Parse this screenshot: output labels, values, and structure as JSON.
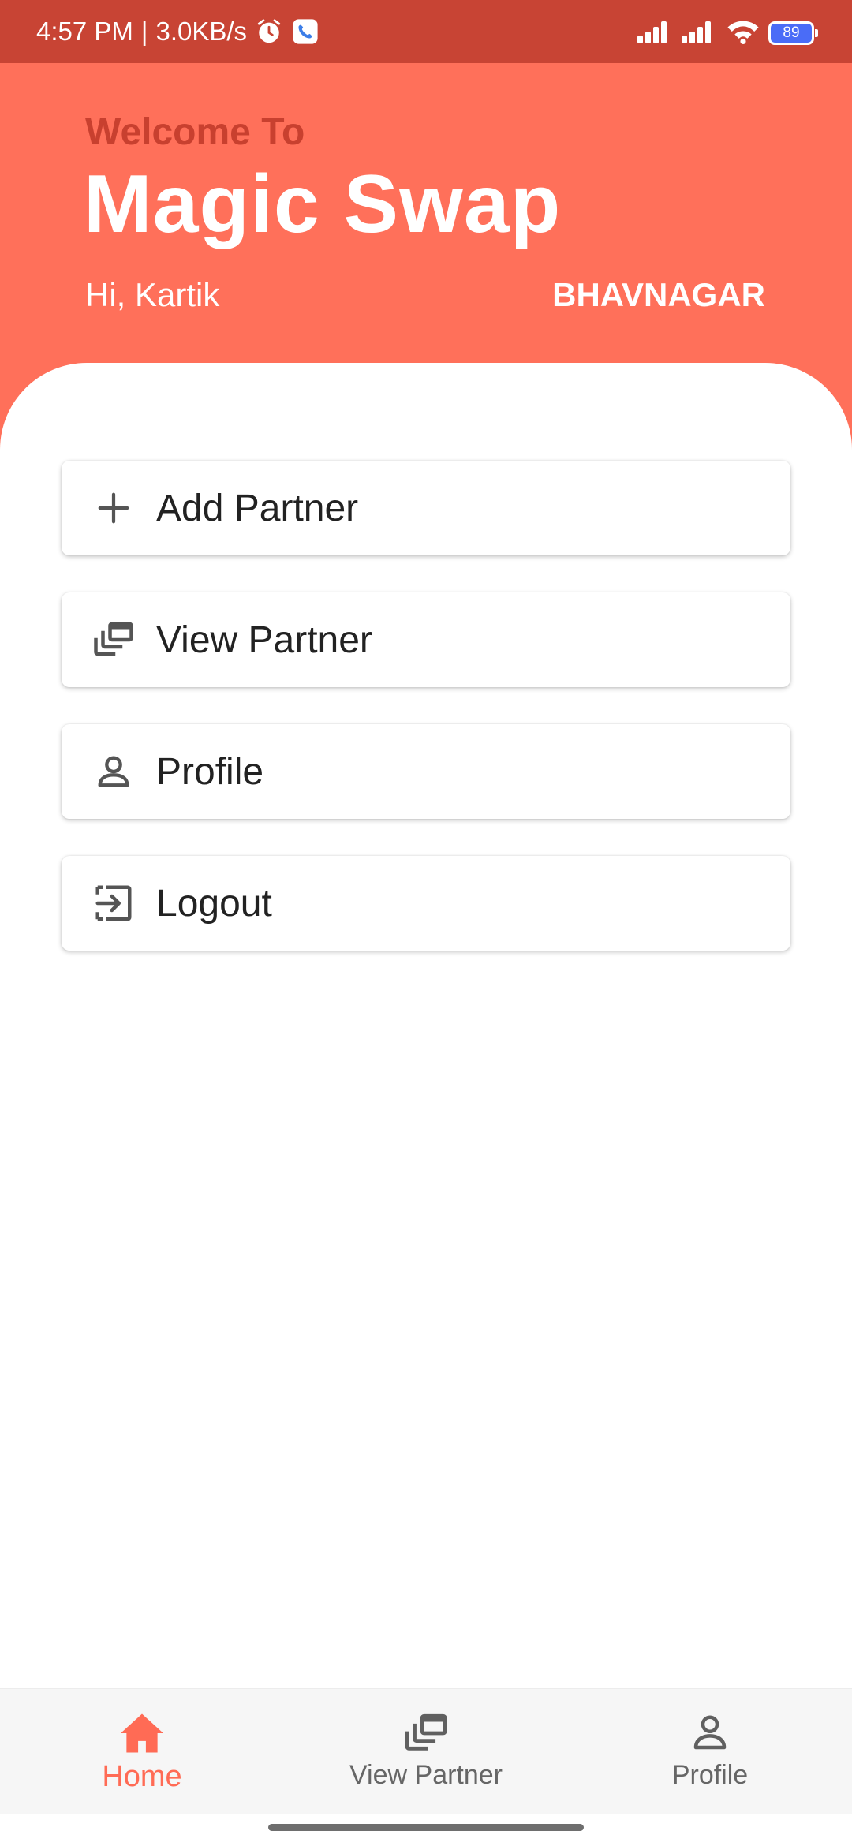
{
  "status_bar": {
    "time": "4:57 PM",
    "separator": "|",
    "network_speed": "3.0KB/s",
    "battery_level": "89",
    "icons": [
      "alarm-icon",
      "phone-call-icon",
      "signal-icon",
      "signal-icon",
      "wifi-icon",
      "battery-icon"
    ]
  },
  "header": {
    "welcome": "Welcome To",
    "app_title": "Magic Swap",
    "greeting": "Hi, Kartik",
    "city": "BHAVNAGAR"
  },
  "menu": {
    "items": [
      {
        "label": "Add Partner",
        "icon": "plus-icon"
      },
      {
        "label": "View Partner",
        "icon": "stacked-windows-icon"
      },
      {
        "label": "Profile",
        "icon": "person-icon"
      },
      {
        "label": "Logout",
        "icon": "logout-icon"
      }
    ]
  },
  "bottom_nav": {
    "items": [
      {
        "label": "Home",
        "icon": "home-icon",
        "active": true
      },
      {
        "label": "View Partner",
        "icon": "stacked-windows-icon",
        "active": false
      },
      {
        "label": "Profile",
        "icon": "person-icon",
        "active": false
      }
    ]
  },
  "colors": {
    "status_bar": "#c84434",
    "header": "#ff705a",
    "welcome_text": "#c8402f",
    "accent": "#ff6b55",
    "nav_inactive": "#666666"
  }
}
